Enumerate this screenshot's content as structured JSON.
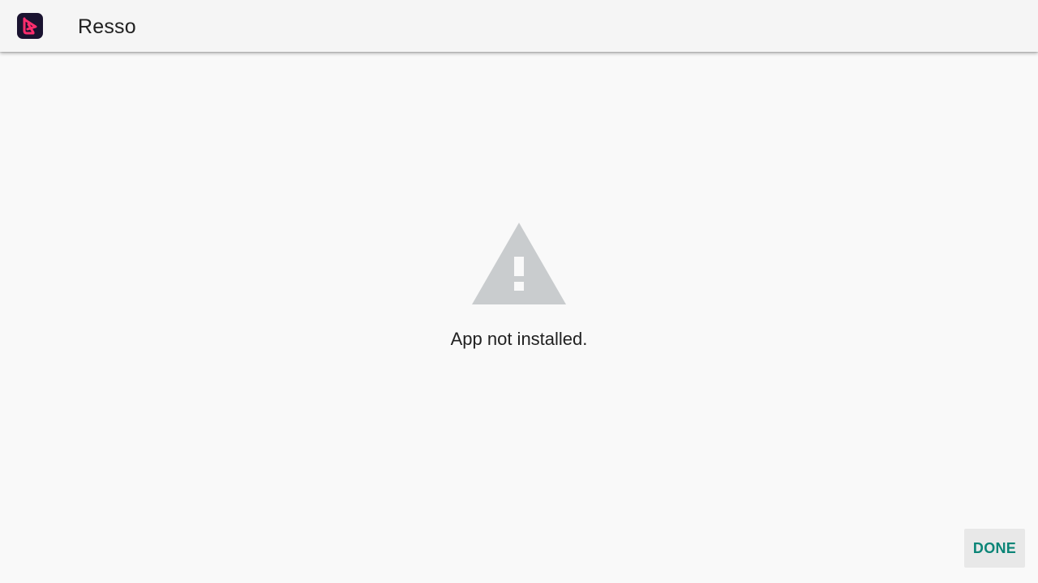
{
  "app_bar": {
    "app_name": "Resso",
    "icon": "resso-app-icon"
  },
  "main": {
    "icon": "warning-icon",
    "message": "App not installed."
  },
  "actions": {
    "done_label": "DONE"
  },
  "colors": {
    "accent": "#0b8577",
    "app_icon_bg": "#1a1330",
    "app_icon_fg": "#ff2d6d",
    "warning_icon": "#c9ccce",
    "background": "#f9f9f9",
    "app_bar_bg": "#f5f5f5"
  }
}
